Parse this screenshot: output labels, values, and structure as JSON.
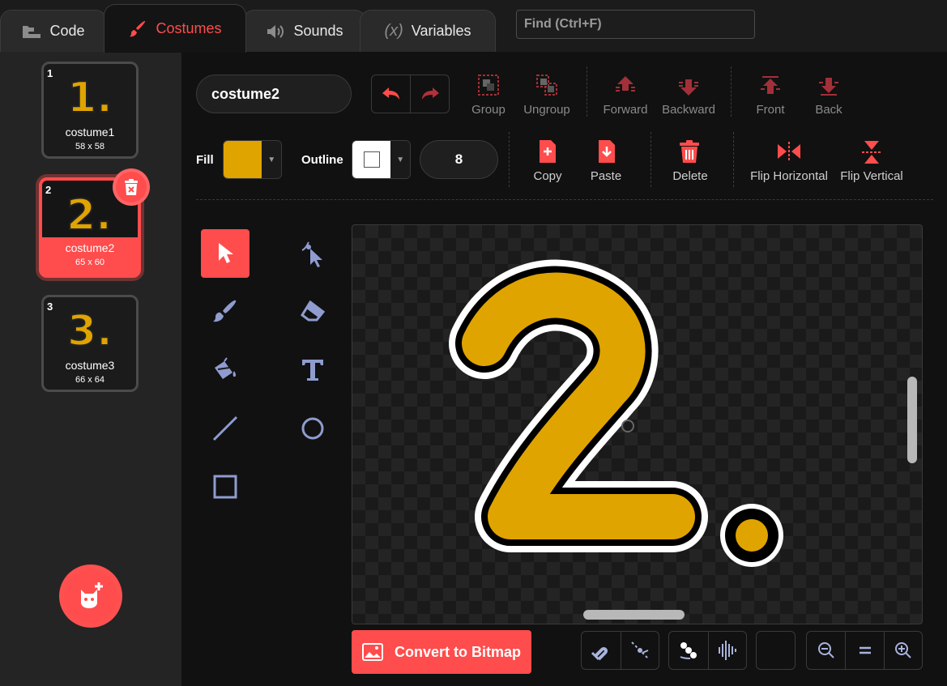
{
  "tabs": {
    "code": "Code",
    "costumes": "Costumes",
    "sounds": "Sounds",
    "variables": "Variables"
  },
  "find": {
    "placeholder": "Find (Ctrl+F)"
  },
  "costumes": [
    {
      "num": "1",
      "glyph": "1.",
      "name": "costume1",
      "size": "58 x 58",
      "selected": false
    },
    {
      "num": "2",
      "glyph": "2.",
      "name": "costume2",
      "size": "65 x 60",
      "selected": true
    },
    {
      "num": "3",
      "glyph": "3.",
      "name": "costume3",
      "size": "66 x 64",
      "selected": false
    }
  ],
  "toolbar": {
    "costume_name": "costume2",
    "group": "Group",
    "ungroup": "Ungroup",
    "forward": "Forward",
    "backward": "Backward",
    "front": "Front",
    "back": "Back",
    "fill_label": "Fill",
    "outline_label": "Outline",
    "outline_width": "8",
    "copy": "Copy",
    "paste": "Paste",
    "delete": "Delete",
    "flip_horizontal": "Flip Horizontal",
    "flip_vertical": "Flip Vertical"
  },
  "colors": {
    "accent": "#ff4c4c",
    "fill": "#e0a400",
    "outline": "#ffffff",
    "tool_icon": "#8f9ccf"
  },
  "tools": [
    "select-icon",
    "reshape-icon",
    "brush-icon",
    "eraser-icon",
    "fill-bucket-icon",
    "text-icon",
    "line-icon",
    "circle-icon",
    "rectangle-icon"
  ],
  "canvas": {
    "glyph": "2."
  },
  "bottom": {
    "convert_label": "Convert to Bitmap"
  }
}
